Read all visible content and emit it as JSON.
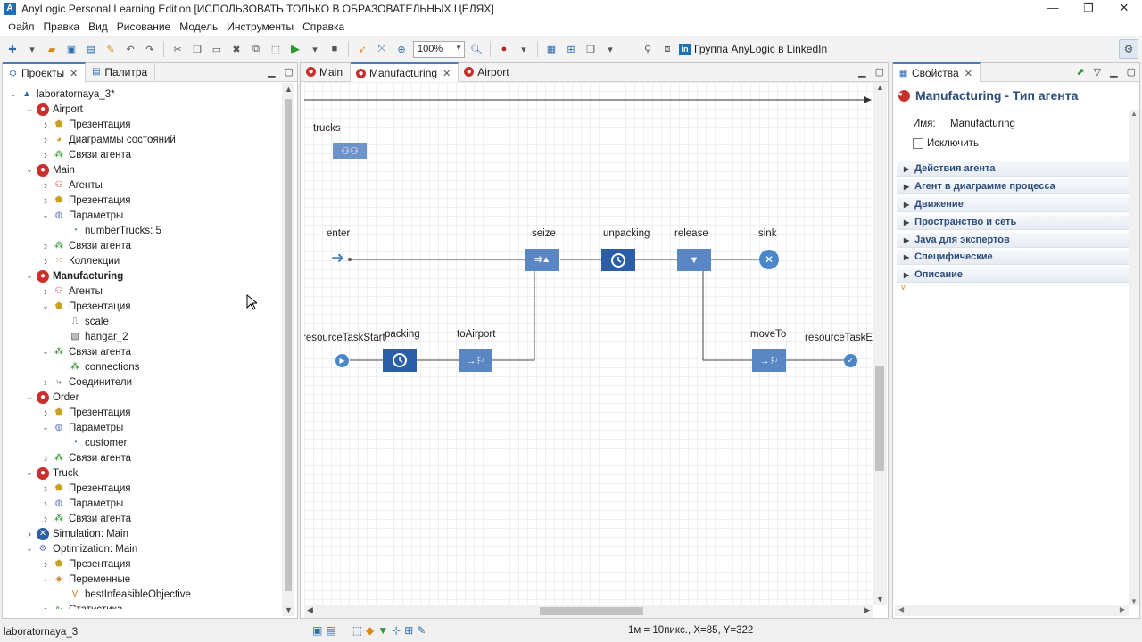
{
  "window": {
    "title": "AnyLogic Personal Learning Edition [ИСПОЛЬЗОВАТЬ ТОЛЬКО В ОБРАЗОВАТЕЛЬНЫХ ЦЕЛЯХ]",
    "minimize": "—",
    "maximize": "❐",
    "close": "✕"
  },
  "menu": [
    "Файл",
    "Правка",
    "Вид",
    "Рисование",
    "Модель",
    "Инструменты",
    "Справка"
  ],
  "toolbar": {
    "zoom": "100%",
    "linkedin_label": "Группа AnyLogic в LinkedIn"
  },
  "projects_panel": {
    "tabs": [
      "Проекты",
      "Палитра"
    ],
    "tree": [
      {
        "label": "laboratornaya_3*",
        "level": 0,
        "arrow": "open",
        "icon": "model-icon"
      },
      {
        "label": "Airport",
        "level": 1,
        "arrow": "open",
        "icon": "agent-type-icon"
      },
      {
        "label": "Презентация",
        "level": 2,
        "arrow": "closed",
        "icon": "presentation-icon"
      },
      {
        "label": "Диаграммы состояний",
        "level": 2,
        "arrow": "closed",
        "icon": "statechart-icon"
      },
      {
        "label": "Связи агента",
        "level": 2,
        "arrow": "closed",
        "icon": "agent-links-icon"
      },
      {
        "label": "Main",
        "level": 1,
        "arrow": "open",
        "icon": "agent-type-icon"
      },
      {
        "label": "Агенты",
        "level": 2,
        "arrow": "closed",
        "icon": "agents-icon"
      },
      {
        "label": "Презентация",
        "level": 2,
        "arrow": "closed",
        "icon": "presentation-icon"
      },
      {
        "label": "Параметры",
        "level": 2,
        "arrow": "open",
        "icon": "parameters-icon"
      },
      {
        "label": "numberTrucks: 5",
        "level": 3,
        "arrow": "none",
        "icon": "parameter-icon"
      },
      {
        "label": "Связи агента",
        "level": 2,
        "arrow": "closed",
        "icon": "agent-links-icon"
      },
      {
        "label": "Коллекции",
        "level": 2,
        "arrow": "closed",
        "icon": "collections-icon"
      },
      {
        "label": "Manufacturing",
        "level": 1,
        "arrow": "open",
        "icon": "agent-type-icon",
        "bold": true
      },
      {
        "label": "Агенты",
        "level": 2,
        "arrow": "closed",
        "icon": "agents-icon"
      },
      {
        "label": "Презентация",
        "level": 2,
        "arrow": "open",
        "icon": "presentation-icon"
      },
      {
        "label": "scale",
        "level": 3,
        "arrow": "none",
        "icon": "scale-icon"
      },
      {
        "label": "hangar_2",
        "level": 3,
        "arrow": "none",
        "icon": "image-icon"
      },
      {
        "label": "Связи агента",
        "level": 2,
        "arrow": "open",
        "icon": "agent-links-icon"
      },
      {
        "label": "connections",
        "level": 3,
        "arrow": "none",
        "icon": "connections-icon"
      },
      {
        "label": "Соединители",
        "level": 2,
        "arrow": "closed",
        "icon": "connectors-icon"
      },
      {
        "label": "Order",
        "level": 1,
        "arrow": "open",
        "icon": "agent-type-icon"
      },
      {
        "label": "Презентация",
        "level": 2,
        "arrow": "closed",
        "icon": "presentation-icon"
      },
      {
        "label": "Параметры",
        "level": 2,
        "arrow": "open",
        "icon": "parameters-icon"
      },
      {
        "label": "customer",
        "level": 3,
        "arrow": "none",
        "icon": "parameter-icon"
      },
      {
        "label": "Связи агента",
        "level": 2,
        "arrow": "closed",
        "icon": "agent-links-icon"
      },
      {
        "label": "Truck",
        "level": 1,
        "arrow": "open",
        "icon": "agent-type-icon"
      },
      {
        "label": "Презентация",
        "level": 2,
        "arrow": "closed",
        "icon": "presentation-icon"
      },
      {
        "label": "Параметры",
        "level": 2,
        "arrow": "closed",
        "icon": "parameters-icon"
      },
      {
        "label": "Связи агента",
        "level": 2,
        "arrow": "closed",
        "icon": "agent-links-icon"
      },
      {
        "label": "Simulation: Main",
        "level": 1,
        "arrow": "closed",
        "icon": "simulation-icon"
      },
      {
        "label": "Optimization: Main",
        "level": 1,
        "arrow": "open",
        "icon": "optimization-icon"
      },
      {
        "label": "Презентация",
        "level": 2,
        "arrow": "closed",
        "icon": "presentation-icon"
      },
      {
        "label": "Переменные",
        "level": 2,
        "arrow": "open",
        "icon": "variables-icon"
      },
      {
        "label": "bestInfeasibleObjective",
        "level": 3,
        "arrow": "none",
        "icon": "variable-icon"
      },
      {
        "label": "Статистика",
        "level": 2,
        "arrow": "closed",
        "icon": "statistics-icon"
      }
    ]
  },
  "editor": {
    "tabs": [
      "Main",
      "Manufacturing",
      "Airport"
    ],
    "active_tab": "Manufacturing",
    "labels": {
      "trucks": "trucks",
      "enter": "enter",
      "seize": "seize",
      "unpacking": "unpacking",
      "release": "release",
      "sink": "sink",
      "resourceTaskStart": "resourceTaskStart",
      "packing": "packing",
      "toAirport": "toAirport",
      "moveTo": "moveTo",
      "resourceTaskEnd": "resourceTaskEn"
    }
  },
  "properties": {
    "tab": "Свойства",
    "title": "Manufacturing - Тип агента",
    "name_label": "Имя:",
    "name_value": "Manufacturing",
    "exclude_label": "Исключить",
    "sections": [
      "Действия агента",
      "Агент в диаграмме процесса",
      "Движение",
      "Пространство и сеть",
      "Java для экспертов",
      "Специфические",
      "Описание"
    ]
  },
  "status": {
    "project": "laboratornaya_3",
    "coords": "1м = 10пикс., X=85, Y=322"
  }
}
